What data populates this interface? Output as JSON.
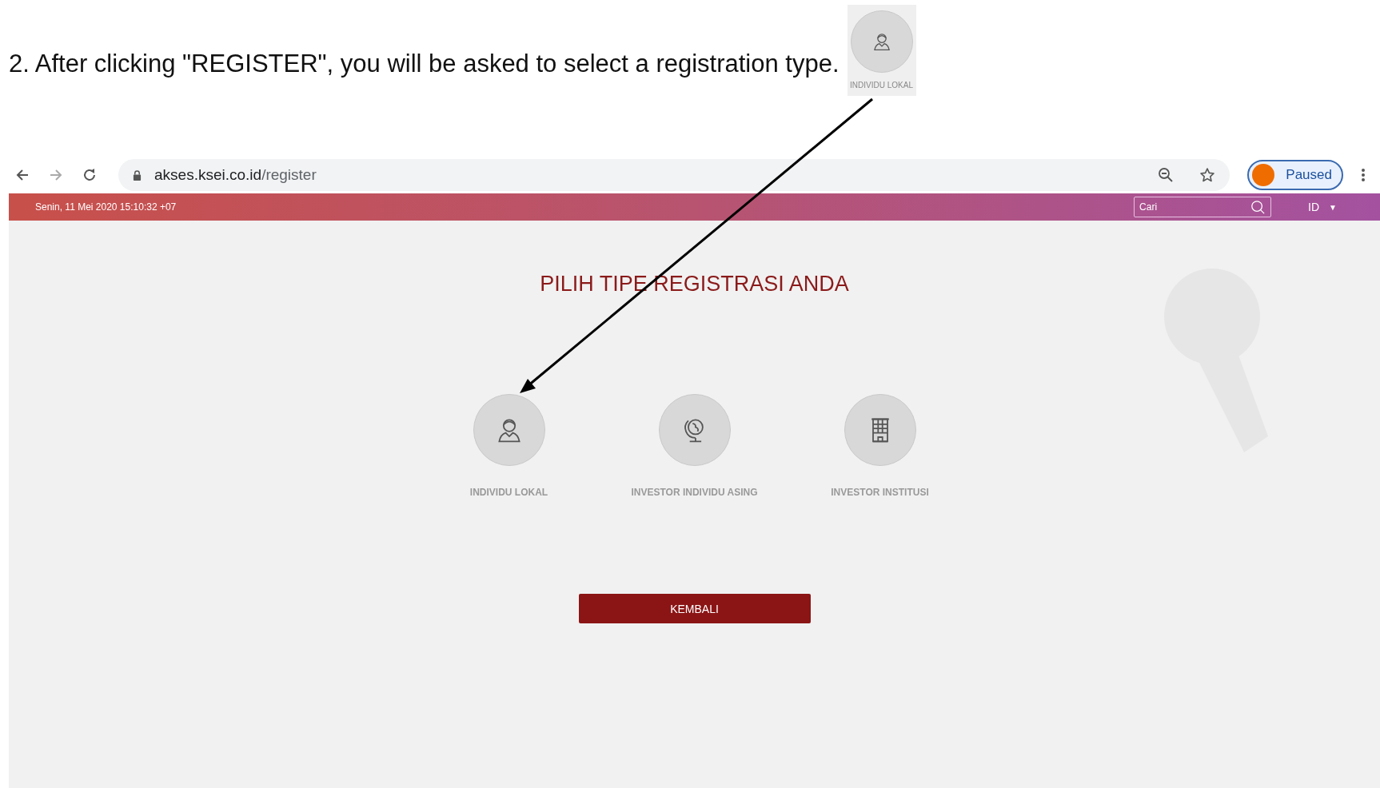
{
  "caption": "2. After clicking \"REGISTER\", you will be asked to select a registration type.",
  "callout": {
    "kind": "person",
    "label": "INDIVIDU LOKAL"
  },
  "browser": {
    "url_host": "akses.ksei.co.id",
    "url_path": "/register",
    "profile_label": "Paused"
  },
  "site_header": {
    "datetime": "Senin, 11 Mei 2020 15:10:32 +07",
    "search_placeholder": "Cari",
    "language": "ID",
    "language_caret": "▼"
  },
  "title": "PILIH TIPE REGISTRASI ANDA",
  "options": [
    {
      "kind": "person",
      "label": "INDIVIDU LOKAL"
    },
    {
      "kind": "globe",
      "label": "INVESTOR INDIVIDU ASING"
    },
    {
      "kind": "building",
      "label": "INVESTOR INSTITUSI"
    }
  ],
  "back_button": "KEMBALI"
}
